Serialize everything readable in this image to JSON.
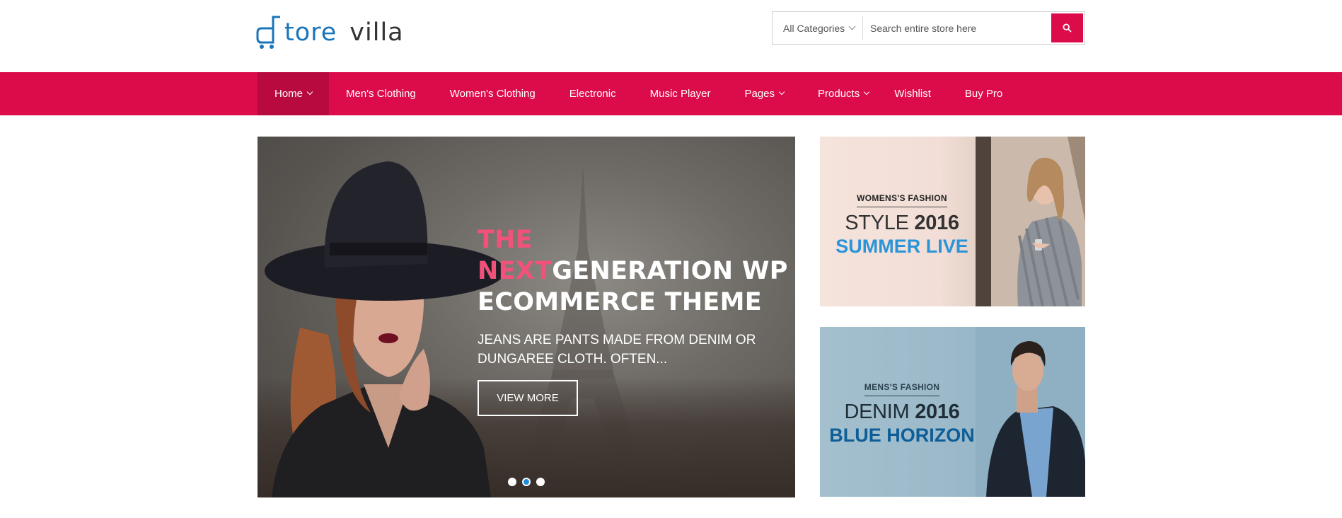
{
  "brand": {
    "name_part1": "tore",
    "name_part2": "villa"
  },
  "search": {
    "category": "All Categories",
    "placeholder": "Search entire store here"
  },
  "nav": {
    "items": [
      {
        "label": "Home",
        "dropdown": true,
        "active": true
      },
      {
        "label": "Men's Clothing",
        "dropdown": false
      },
      {
        "label": "Women's Clothing",
        "dropdown": false
      },
      {
        "label": "Electronic",
        "dropdown": false
      },
      {
        "label": "Music Player",
        "dropdown": false
      },
      {
        "label": "Pages",
        "dropdown": true
      },
      {
        "label": "Products",
        "dropdown": true
      },
      {
        "label": "Wishlist",
        "dropdown": false
      },
      {
        "label": "Buy Pro",
        "dropdown": false
      }
    ]
  },
  "hero": {
    "title_pink_1": "THE",
    "title_pink_2": "NEXT",
    "title_white_1": "GENERATION WP",
    "title_white_2": "ECOMMERCE THEME",
    "subtitle": "JEANS ARE PANTS MADE FROM DENIM OR DUNGAREE CLOTH. OFTEN...",
    "button": "VIEW MORE",
    "slides": 3,
    "active_slide": 2
  },
  "banners": {
    "women": {
      "kicker": "WOMENS'S FASHION",
      "line1_light": "STYLE",
      "line1_bold": "2016",
      "headline": "SUMMER LIVE"
    },
    "men": {
      "kicker": "MENS'S FASHION",
      "line1_light": "DENIM",
      "line1_bold": "2016",
      "headline": "BLUE HORIZON"
    }
  },
  "colors": {
    "brand_red": "#dc0c4a",
    "nav_active": "#b80a3e",
    "logo_blue": "#1a75bb",
    "hero_pink": "#f0527a",
    "dot_active": "#1c8fd6"
  }
}
